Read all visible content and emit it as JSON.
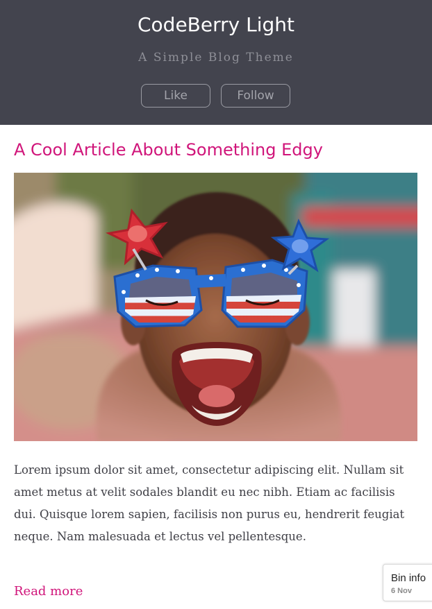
{
  "header": {
    "title": "CodeBerry Light",
    "tagline": "A Simple Blog Theme",
    "buttons": {
      "like": "Like",
      "follow": "Follow"
    },
    "background_color": "#43444e"
  },
  "post": {
    "title": "A Cool Article About Something Edgy",
    "image": {
      "subject": "laughing-child-with-star-glasses"
    },
    "body": "Lorem ipsum dolor sit amet, consectetur adipiscing elit. Nullam sit amet metus at velit sodales blandit eu nec nibh. Etiam ac facilisis dui. Quisque lorem sapien, facilisis non purus eu, hendrerit feugiat neque. Nam malesuada et lectus vel pellentesque.",
    "read_more": "Read more",
    "accent_color": "#d0157a"
  },
  "bin_widget": {
    "label": "Bin info",
    "date": "6 Nov"
  }
}
